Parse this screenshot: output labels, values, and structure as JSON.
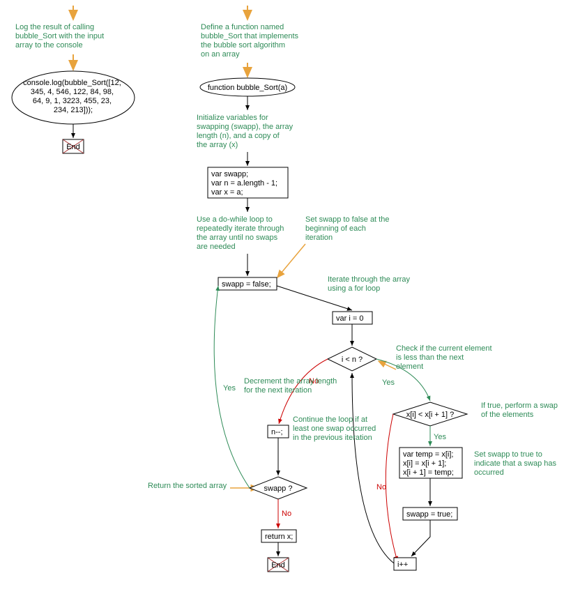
{
  "left": {
    "annot1_l1": "Log the result of calling",
    "annot1_l2": "bubble_Sort with the input",
    "annot1_l3": "array to the console",
    "node1_l1": "console.log(bubble_Sort([12,",
    "node1_l2": "345, 4, 546, 122, 84, 98,",
    "node1_l3": "64, 9, 1, 3223, 455, 23,",
    "node1_l4": "234, 213]));",
    "end": "End"
  },
  "right": {
    "annot_def_l1": "Define a function named",
    "annot_def_l2": "bubble_Sort that implements",
    "annot_def_l3": "the bubble sort algorithm",
    "annot_def_l4": "on an array",
    "func": "function bubble_Sort(a)",
    "annot_init_l1": "Initialize variables for",
    "annot_init_l2": "swapping (swapp), the array",
    "annot_init_l3": "length (n), and a copy of",
    "annot_init_l4": "the array (x)",
    "init_l1": "var swapp;",
    "init_l2": "var n = a.length - 1;",
    "init_l3": "var x = a;",
    "annot_dowhile_l1": "Use a do-while loop to",
    "annot_dowhile_l2": "repeatedly iterate through",
    "annot_dowhile_l3": "the array until no swaps",
    "annot_dowhile_l4": "are needed",
    "annot_setfalse_l1": "Set swapp to false at the",
    "annot_setfalse_l2": "beginning of each",
    "annot_setfalse_l3": "iteration",
    "swapp_false": "swapp = false;",
    "annot_for_l1": "Iterate through the array",
    "annot_for_l2": "using a for loop",
    "vari0": "var i = 0",
    "cond_in": "i < n ?",
    "annot_checkless_l1": "Check if the current element",
    "annot_checkless_l2": "is less than the next",
    "annot_checkless_l3": "element",
    "cond_xi": "x[i] < x[i + 1] ?",
    "annot_swap_l1": "If true, perform a swap",
    "annot_swap_l2": "of the elements",
    "swap_l1": "var temp = x[i];",
    "swap_l2": "x[i] = x[i + 1];",
    "swap_l3": "x[i + 1] = temp;",
    "annot_settrue_l1": "Set swapp to true to",
    "annot_settrue_l2": "indicate that a swap has",
    "annot_settrue_l3": "occurred",
    "swapp_true": "swapp = true;",
    "ipp": "i++",
    "annot_dec_l1": "Decrement the array length",
    "annot_dec_l2": "for the next iteration",
    "ndec": "n--;",
    "annot_cont_l1": "Continue the loop if at",
    "annot_cont_l2": "least one swap occurred",
    "annot_cont_l3": "in the previous iteration",
    "cond_swapp": "swapp ?",
    "annot_ret": "Return the sorted array",
    "retx": "return x;",
    "end": "End",
    "yes": "Yes",
    "no": "No"
  },
  "chart_data": {
    "type": "flowchart",
    "entry_points": [
      "left_start",
      "right_start"
    ],
    "nodes": [
      {
        "id": "left_start",
        "type": "start",
        "label": ""
      },
      {
        "id": "left_call",
        "type": "terminator",
        "label": "console.log(bubble_Sort([12, 345, 4, 546, 122, 84, 98, 64, 9, 1, 3223, 455, 23, 234, 213]));",
        "annotation": "Log the result of calling bubble_Sort with the input array to the console"
      },
      {
        "id": "left_end",
        "type": "end",
        "label": "End"
      },
      {
        "id": "right_start",
        "type": "start",
        "label": ""
      },
      {
        "id": "func_def",
        "type": "terminator",
        "label": "function bubble_Sort(a)",
        "annotation": "Define a function named bubble_Sort that implements the bubble sort algorithm on an array"
      },
      {
        "id": "init_vars",
        "type": "process",
        "label": "var swapp; var n = a.length - 1; var x = a;",
        "annotation": "Initialize variables for swapping (swapp), the array length (n), and a copy of the array (x)"
      },
      {
        "id": "swapp_false",
        "type": "process",
        "label": "swapp = false;",
        "annotation": "Set swapp to false at the beginning of each iteration; Use a do-while loop to repeatedly iterate through the array until no swaps are needed"
      },
      {
        "id": "var_i0",
        "type": "process",
        "label": "var i = 0",
        "annotation": "Iterate through the array using a for loop"
      },
      {
        "id": "cond_in",
        "type": "decision",
        "label": "i < n ?"
      },
      {
        "id": "cond_xi",
        "type": "decision",
        "label": "x[i] < x[i + 1] ?",
        "annotation": "Check if the current element is less than the next element"
      },
      {
        "id": "swap_block",
        "type": "process",
        "label": "var temp = x[i]; x[i] = x[i + 1]; x[i + 1] = temp;",
        "annotation": "If true, perform a swap of the elements"
      },
      {
        "id": "swapp_true",
        "type": "process",
        "label": "swapp = true;",
        "annotation": "Set swapp to true to indicate that a swap has occurred"
      },
      {
        "id": "ipp",
        "type": "process",
        "label": "i++"
      },
      {
        "id": "ndec",
        "type": "process",
        "label": "n--;",
        "annotation": "Decrement the array length for the next iteration"
      },
      {
        "id": "cond_swapp",
        "type": "decision",
        "label": "swapp ?",
        "annotation": "Continue the loop if at least one swap occurred in the previous iteration"
      },
      {
        "id": "retx",
        "type": "process",
        "label": "return x;",
        "annotation": "Return the sorted array"
      },
      {
        "id": "right_end",
        "type": "end",
        "label": "End"
      }
    ],
    "edges": [
      {
        "from": "left_start",
        "to": "left_call"
      },
      {
        "from": "left_call",
        "to": "left_end"
      },
      {
        "from": "right_start",
        "to": "func_def"
      },
      {
        "from": "func_def",
        "to": "init_vars"
      },
      {
        "from": "init_vars",
        "to": "swapp_false"
      },
      {
        "from": "swapp_false",
        "to": "var_i0"
      },
      {
        "from": "var_i0",
        "to": "cond_in"
      },
      {
        "from": "cond_in",
        "to": "cond_xi",
        "label": "Yes"
      },
      {
        "from": "cond_in",
        "to": "ndec",
        "label": "No"
      },
      {
        "from": "cond_xi",
        "to": "swap_block",
        "label": "Yes"
      },
      {
        "from": "cond_xi",
        "to": "ipp",
        "label": "No"
      },
      {
        "from": "swap_block",
        "to": "swapp_true"
      },
      {
        "from": "swapp_true",
        "to": "ipp"
      },
      {
        "from": "ipp",
        "to": "cond_in"
      },
      {
        "from": "ndec",
        "to": "cond_swapp"
      },
      {
        "from": "cond_swapp",
        "to": "swapp_false",
        "label": "Yes"
      },
      {
        "from": "cond_swapp",
        "to": "retx",
        "label": "No"
      },
      {
        "from": "retx",
        "to": "right_end"
      }
    ]
  }
}
